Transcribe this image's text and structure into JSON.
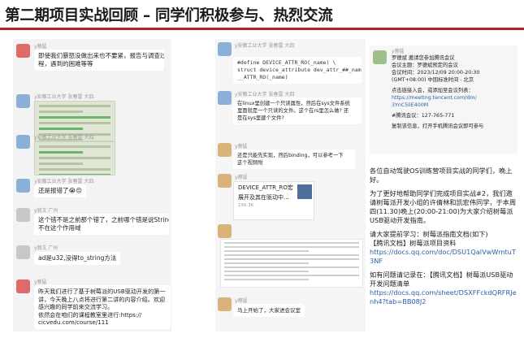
{
  "slide": {
    "title": "第二期项目实战回顾 – 同学们积极参与、热烈交流"
  },
  "left_chat": {
    "msg1": {
      "sender": "y蔡猛",
      "lines": [
        "即使我们暴怒没做出来也不要紧，报告与调查过",
        "程，遇到的困难等等"
      ]
    },
    "msg2": {
      "sender": "y安徽工业大学 张春雷 大四"
    },
    "msg3": {
      "sender": "y安徽工业大学 张春雷 大四"
    },
    "msg4": {
      "sender": "y安徽工业大学 张春雷 大四",
      "text": "还是报错了😭😔"
    },
    "msg5": {
      "sender": "y翁文 广州",
      "lines": [
        "这个错不是之前那个错了，之前哪个错是说String",
        "不在这个作用域"
      ]
    },
    "msg6": {
      "sender": "y翁文 广州",
      "text": "ad是u32,没得to_string方法"
    },
    "msg7": {
      "sender": "y蔡猛",
      "lines": [
        "昨天我们进行了基于树莓派的USB驱动开发的第一",
        "讲，今天晚上八点将进行第二讲的内容介绍。欢迎",
        "感兴趣的同学前来交流学习。",
        "依然会在咱们的课程教室里进行:https://",
        "cicvedu.com/course/111"
      ]
    }
  },
  "mid_chat": {
    "code_sender": "y安徽工业大学 张春雷 大四",
    "code_lines": [
      "#define DEVICE_ATTR_RO(_name) \\",
      "    struct device_attribute dev_attr_##_name =",
      "__ATTR_RO(_name)"
    ],
    "q_sender": "y安徽工业大学 张春雷 大四",
    "q_lines": [
      "在linux里创建一个只读属性，然后在sys文件系统",
      "里面就是一个只读的文件。这个在rs里怎么做? 还",
      "是在sys里建个文件?"
    ],
    "reply_sender": "y蔡猛",
    "reply_lines": [
      "还是只能先实现，然后binding，可以参考一下",
      "这个视频附"
    ],
    "card_sender": "y蔡猛",
    "card_title_lines": [
      "DEVICE_ATTR_RO宏",
      "展开及其在驱动中..."
    ],
    "card_count": "156.3K",
    "bottom_sender": "y蔡猛",
    "bottom_text": "马上开始了，大家进会议室"
  },
  "meeting": {
    "sender": "y蔡猛",
    "lines": [
      "罗德斌 邀请您参加腾讯会议",
      "会议主题：罗德斌预定的会议",
      "会议时间：2023/12/09 20:00-20:30",
      "(GMT+08:00) 中国标准时间 - 北京",
      "",
      "点击链接入会，或添加至会议列表：",
      "https://meeting.tencent.com/dm/",
      "3YnC5liE400M",
      "",
      "#腾讯会议：127-765-771",
      "",
      "复制该信息，打开手机腾讯会议即可参与"
    ]
  },
  "notice": {
    "p1": "各位自动驾驶OS训练营项目实战的同学们，晚上好。",
    "p2": "为了更好地帮助同学们完成项目实战#2，我们邀请树莓派开发小组的许倩林和凯宏伟同学，于本周四(11.30)晚上(20:00-21:00)为大家介绍树莓派USB驱动开发指南。",
    "p3_intro": "请大家提前学习：树莓派指南文档(如下)",
    "p3_doc": "【腾讯文档】树莓派项目资料",
    "p3_link": "https://docs.qq.com/doc/DSU1QalVwWmtuT3NF",
    "p4_intro": "如有问题请记录在：【腾讯文档】树莓派USB驱动开发问题清单",
    "p4_link": "https://docs.qq.com/sheet/DSXFFckdQRFRJenh4?tab=BB08J2"
  }
}
